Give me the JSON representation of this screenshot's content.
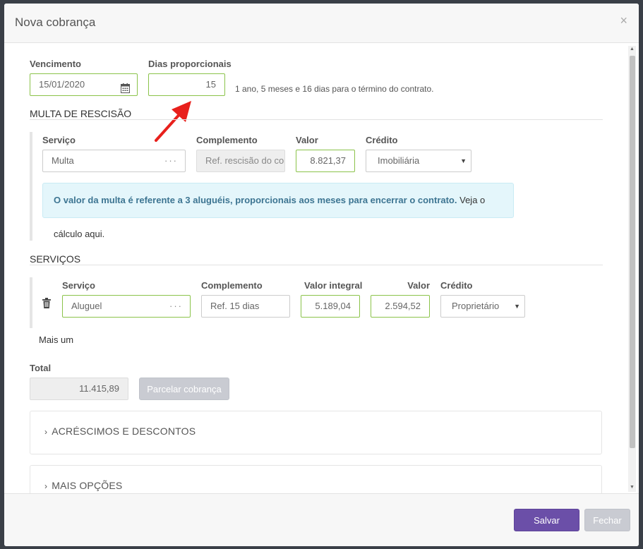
{
  "modal": {
    "title": "Nova cobrança",
    "close": "×"
  },
  "top": {
    "vencimento_label": "Vencimento",
    "vencimento_value": "15/01/2020",
    "dias_label": "Dias proporcionais",
    "dias_value": "15",
    "contract_info": "1 ano, 5 meses e 16 dias para o término do contrato."
  },
  "multa": {
    "title": "MULTA DE RESCISÃO",
    "servico_label": "Serviço",
    "servico_value": "Multa",
    "complemento_label": "Complemento",
    "complemento_value": "Ref. rescisão do contrato",
    "valor_label": "Valor",
    "valor_value": "8.821,37",
    "credito_label": "Crédito",
    "credito_value": "Imobiliária",
    "info_bold": "O valor da multa é referente a 3 aluguéis, proporcionais aos meses para encerrar o contrato.",
    "info_link": "Veja o cálculo aqui."
  },
  "servicos": {
    "title": "SERVIÇOS",
    "servico_label": "Serviço",
    "complemento_label": "Complemento",
    "valor_integral_label": "Valor integral",
    "valor_label": "Valor",
    "credito_label": "Crédito",
    "row": {
      "servico": "Aluguel",
      "complemento": "Ref. 15 dias",
      "valor_integral": "5.189,04",
      "valor": "2.594,52",
      "credito": "Proprietário"
    },
    "add_more": "Mais um"
  },
  "total": {
    "label": "Total",
    "value": "11.415,89",
    "parcelar_button": "Parcelar cobrança"
  },
  "panels": {
    "acrescimos": "ACRÉSCIMOS E DESCONTOS",
    "mais_opcoes": "MAIS OPÇÕES"
  },
  "footer": {
    "save": "Salvar",
    "close": "Fechar"
  },
  "colors": {
    "accent": "#6b4fa8",
    "valid_border": "#8bc34a",
    "info_bg": "#e4f6fb",
    "info_text": "#3d7592",
    "annotation_arrow": "#e8201c"
  },
  "icons": {
    "calendar": "calendar-icon",
    "trash": "trash-icon",
    "chevron": "chevron-right-icon",
    "arrow": "red-arrow-annotation"
  }
}
